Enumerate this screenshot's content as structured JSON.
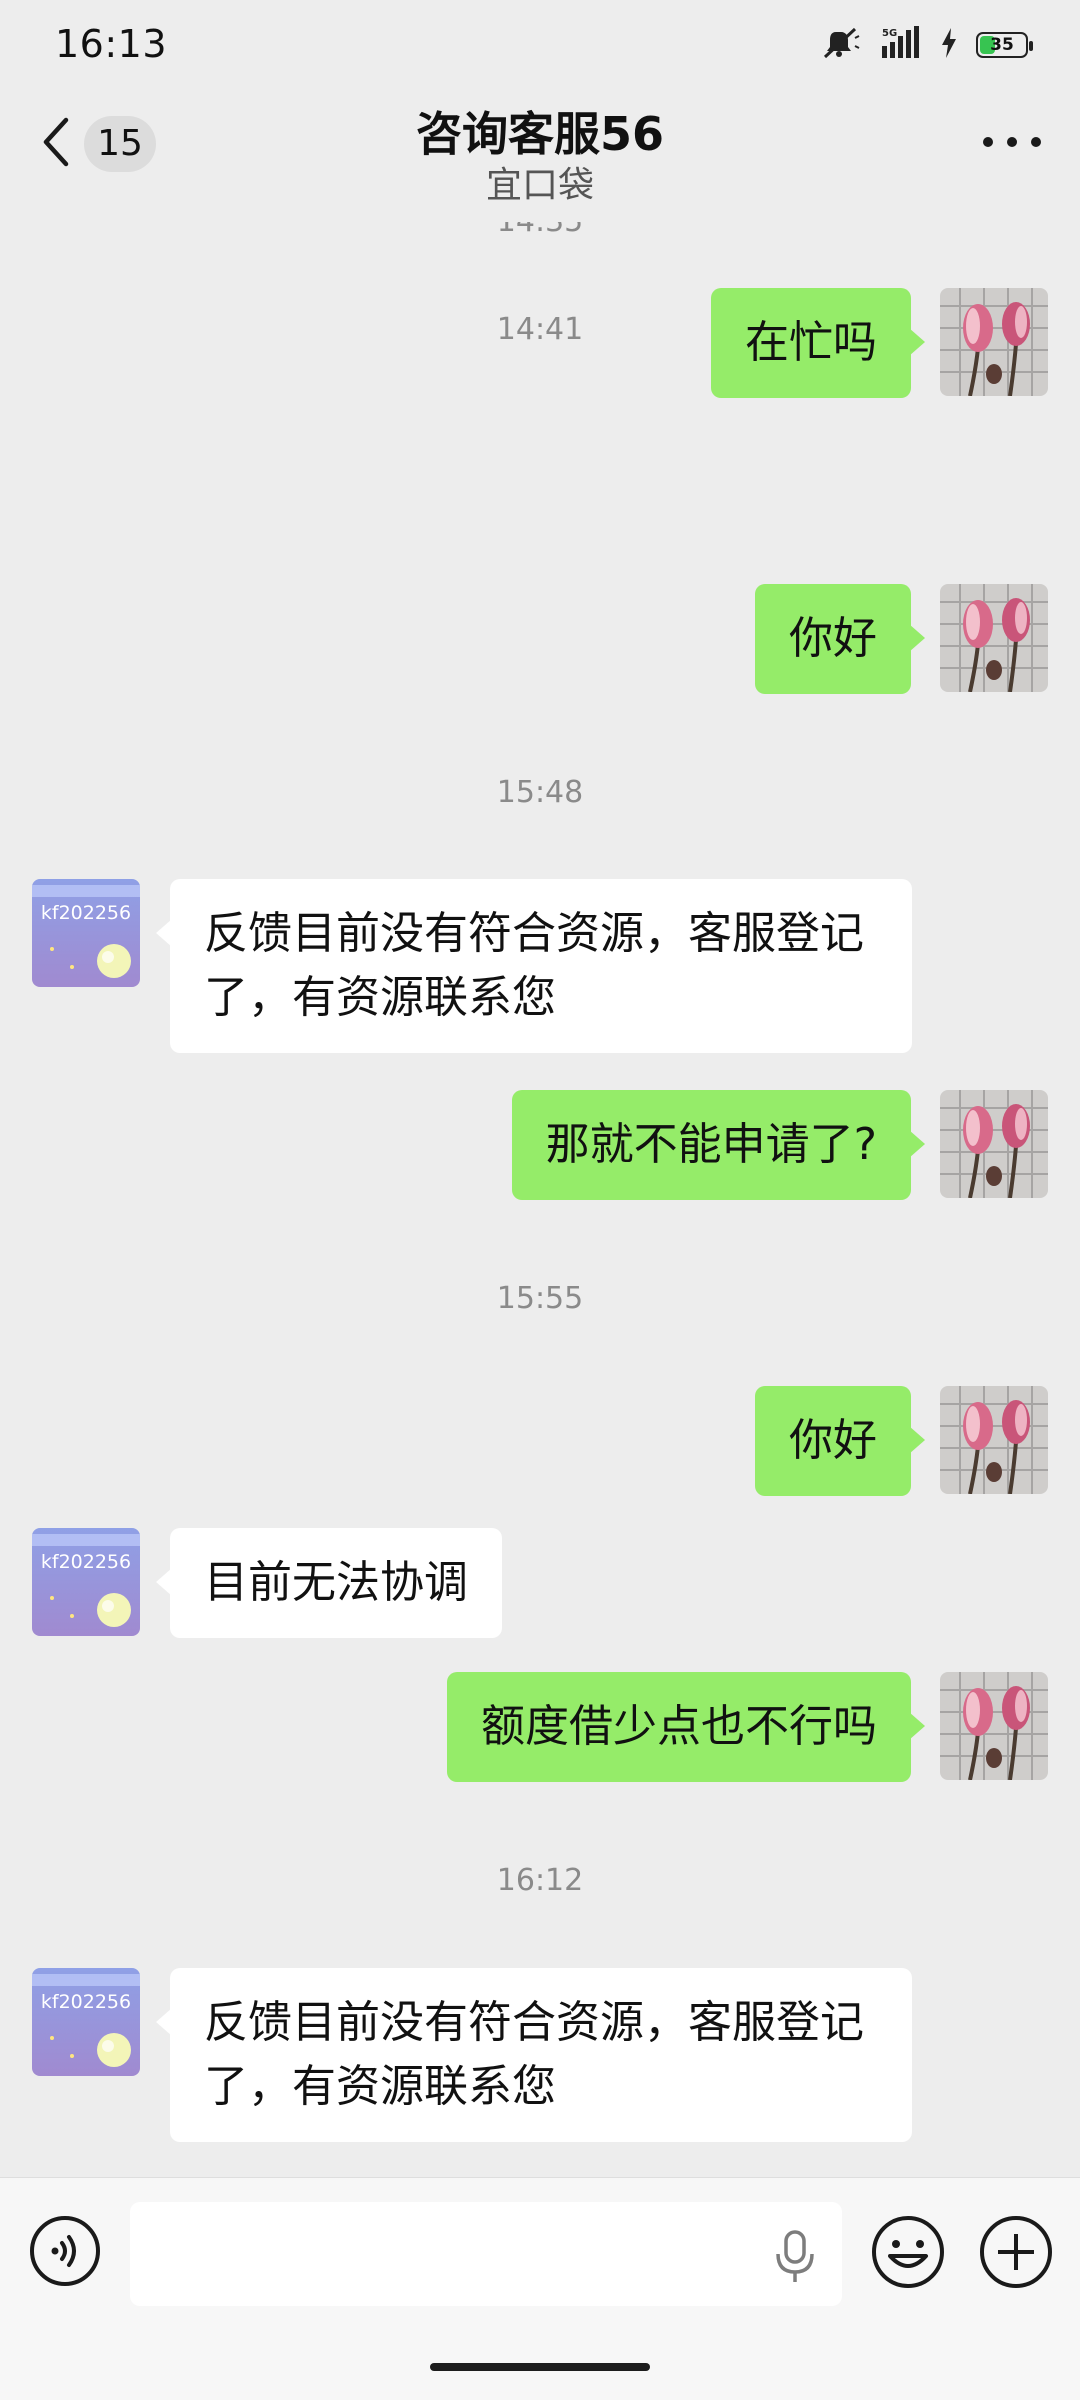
{
  "status_bar": {
    "time": "16:13",
    "network": "5G",
    "battery_level": 35,
    "battery_label": "35",
    "icons": [
      "mute-vibrate-icon",
      "signal-5g-icon",
      "charging-icon",
      "battery-icon"
    ]
  },
  "header": {
    "unread_count": "15",
    "title": "咨询客服56",
    "subtitle": "宜口袋",
    "back_icon": "chevron-left-icon",
    "more_icon": "more-dots-icon"
  },
  "chat": {
    "timestamps": [
      "14:41",
      "15:48",
      "15:55",
      "16:12"
    ],
    "messages": [
      {
        "side": "right",
        "text": "在忙吗"
      },
      {
        "side": "right",
        "text": "你好"
      },
      {
        "side": "left",
        "text": "反馈目前没有符合资源，客服登记了，有资源联系您"
      },
      {
        "side": "right",
        "text": "那就不能申请了?"
      },
      {
        "side": "right",
        "text": "你好"
      },
      {
        "side": "left",
        "text": "目前无法协调"
      },
      {
        "side": "right",
        "text": "额度借少点也不行吗"
      },
      {
        "side": "left",
        "text": "反馈目前没有符合资源，客服登记了，有资源联系您"
      }
    ],
    "agent_avatar_text": "kf202256",
    "colors": {
      "outgoing_bubble": "#95ec69",
      "incoming_bubble": "#ffffff",
      "background": "#ededed"
    }
  },
  "input_bar": {
    "placeholder": "",
    "icons": [
      "voice-icon",
      "microphone-icon",
      "emoji-icon",
      "plus-icon"
    ]
  }
}
